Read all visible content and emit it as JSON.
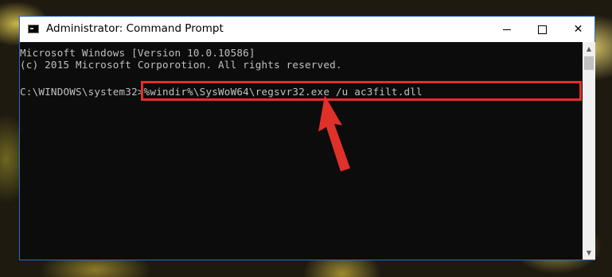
{
  "window": {
    "title": "Administrator: Command Prompt",
    "controls": {
      "minimize": "minimize",
      "maximize": "maximize",
      "close": "✕"
    }
  },
  "console": {
    "lines": [
      "Microsoft Windows [Version 10.0.10586]",
      "(c) 2015 Microsoft Corporotion. All rights reserved.",
      "C:\\WINDOWS\\system32>%windir%\\SysWoW64\\regsvr32.exe /u ac3filt.dll"
    ]
  },
  "scrollbar": {
    "up_icon": "▲",
    "down_icon": "▼"
  },
  "colors": {
    "highlight": "#e0302a",
    "arrow": "#e0302a",
    "console_bg": "#0c0c0c",
    "console_text": "#c0c0c0"
  }
}
